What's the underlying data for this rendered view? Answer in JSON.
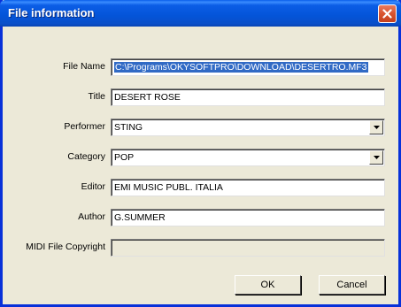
{
  "dialog": {
    "title": "File information",
    "close_icon": "close-icon"
  },
  "fields": {
    "file_name": {
      "label": "File Name",
      "value": "C:\\Programs\\OKYSOFTPRO\\DOWNLOAD\\DESERTRO.MF3"
    },
    "title": {
      "label": "Title",
      "value": "DESERT ROSE"
    },
    "performer": {
      "label": "Performer",
      "value": "STING"
    },
    "category": {
      "label": "Category",
      "value": "POP"
    },
    "editor": {
      "label": "Editor",
      "value": "EMI MUSIC PUBL. ITALIA"
    },
    "author": {
      "label": "Author",
      "value": "G.SUMMER"
    },
    "midi_copyright": {
      "label": "MIDI File Copyright",
      "value": ""
    }
  },
  "buttons": {
    "ok": "OK",
    "cancel": "Cancel"
  },
  "colors": {
    "titlebar": "#0454d8",
    "dialog_bg": "#ece9d8",
    "selection": "#316ac5",
    "close_button": "#d9542f"
  }
}
